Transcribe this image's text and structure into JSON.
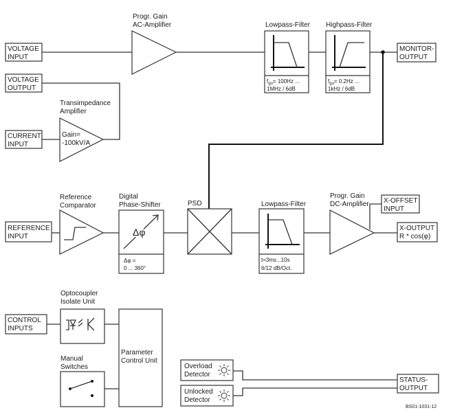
{
  "voltage_input": [
    "VOLTAGE",
    "INPUT"
  ],
  "voltage_output": [
    "VOLTAGE",
    "OUTPUT"
  ],
  "current_input": [
    "CURRENT",
    "INPUT"
  ],
  "ac_amp_label": [
    "Progr. Gain",
    "AC-Amplifier"
  ],
  "transimpedance_label": [
    "Transimpedance",
    "Amplifier"
  ],
  "transimpedance_gain": [
    "Gain=",
    "-100kV/A"
  ],
  "lowpass_top": {
    "label": "Lowpass-Filter",
    "f": "f",
    "sub": "go",
    "line1": "= 100Hz ...",
    "line2": "1MHz / 6dB"
  },
  "highpass": {
    "label": "Highpass-Filter",
    "f": "f",
    "sub": "gu",
    "line1": "= 0.2Hz ...",
    "line2": "1kHz / 6dB"
  },
  "monitor_output": [
    "MONITOR-",
    "OUTPUT"
  ],
  "reference_input": [
    "REFERENCE",
    "INPUT"
  ],
  "comparator_label": [
    "Reference",
    "Comparator"
  ],
  "phase_shifter": {
    "label": [
      "Digital",
      "Phase-Shifter"
    ],
    "symbol": "Δφ",
    "range": [
      "Δφ =",
      "0 ... 360°"
    ]
  },
  "psd_label": "PSD",
  "lowpass_bottom": {
    "label": "Lowpass-Filter",
    "line1": "t=3ms...10s",
    "line2": "6/12 dB/Oct."
  },
  "dc_amp_label": [
    "Progr. Gain",
    "DC-Amplifier"
  ],
  "x_offset_input": [
    "X-OFFSET",
    "INPUT"
  ],
  "x_output": [
    "X-OUTPUT",
    "R * cos(φ)"
  ],
  "control_inputs": [
    "CONTROL",
    "INPUTS"
  ],
  "optocoupler_label": [
    "Optocoupler",
    "Isolate Unit"
  ],
  "manual_switches_label": [
    "Manual",
    "Switches"
  ],
  "parameter_control": [
    "Parameter",
    "Control Unit"
  ],
  "overload_detector": [
    "Overload",
    "Detector"
  ],
  "unlocked_detector": [
    "Unlocked",
    "Detector"
  ],
  "status_output": [
    "STATUS-",
    "OUTPUT"
  ],
  "figure_code": "BS01-1031-12",
  "icons": {
    "detector": "light-indicator-icon",
    "optocoupler": "optocoupler-icon",
    "switch": "switch-icon"
  }
}
